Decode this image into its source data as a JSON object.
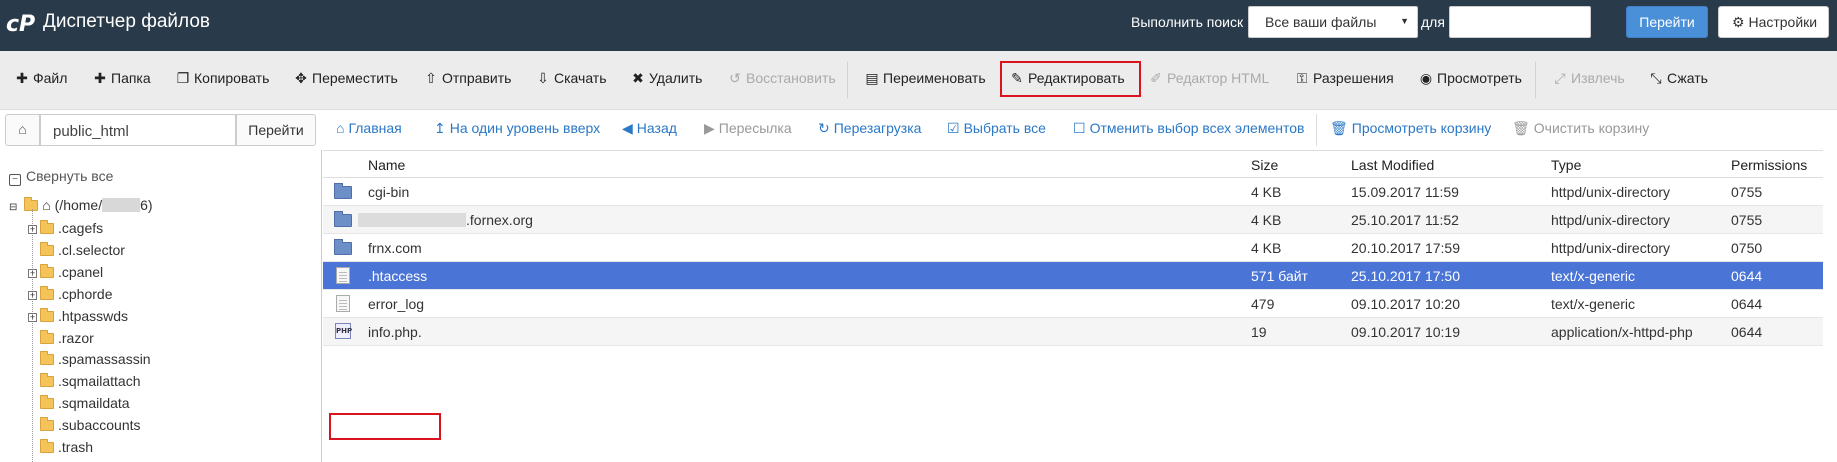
{
  "header": {
    "app_title": "Диспетчер файлов",
    "search_label": "Выполнить поиск",
    "search_scope": "Все ваши файлы",
    "for_label": "для",
    "search_value": "",
    "go_label": "Перейти",
    "settings_label": "Настройки"
  },
  "toolbar": {
    "file": "Файл",
    "folder": "Папка",
    "copy": "Копировать",
    "move": "Переместить",
    "upload": "Отправить",
    "download": "Скачать",
    "delete": "Удалить",
    "restore": "Восстановить",
    "rename": "Переименовать",
    "edit": "Редактировать",
    "html_editor": "Редактор HTML",
    "permissions": "Разрешения",
    "view": "Просмотреть",
    "extract": "Извлечь",
    "compress": "Сжать"
  },
  "pathbar": {
    "path": "public_html",
    "go_label": "Перейти",
    "home": "Главная",
    "up_one_level": "На один уровень вверх",
    "back": "Назад",
    "forward": "Пересылка",
    "reload": "Перезагрузка",
    "select_all": "Выбрать все",
    "deselect_all": "Отменить выбор всех элементов",
    "view_trash": "Просмотреть корзину",
    "empty_trash": "Очистить корзину"
  },
  "tree": {
    "collapse_all": "Свернуть все",
    "root_prefix": "(/home/",
    "root_suffix": "6)",
    "items": [
      {
        "name": ".cagefs",
        "expandable": true
      },
      {
        "name": ".cl.selector",
        "expandable": false
      },
      {
        "name": ".cpanel",
        "expandable": true
      },
      {
        "name": ".cphorde",
        "expandable": true
      },
      {
        "name": ".htpasswds",
        "expandable": true
      },
      {
        "name": ".razor",
        "expandable": false
      },
      {
        "name": ".spamassassin",
        "expandable": false
      },
      {
        "name": ".sqmailattach",
        "expandable": false
      },
      {
        "name": ".sqmaildata",
        "expandable": false
      },
      {
        "name": ".subaccounts",
        "expandable": false
      },
      {
        "name": ".trash",
        "expandable": false
      }
    ]
  },
  "files": {
    "columns": [
      "Name",
      "Size",
      "Last Modified",
      "Type",
      "Permissions"
    ],
    "rows": [
      {
        "icon": "folder-icon",
        "name": "cgi-bin",
        "size": "4 KB",
        "modified": "15.09.2017 11:59",
        "type": "httpd/unix-directory",
        "perms": "0755"
      },
      {
        "icon": "folder-icon",
        "name": ".fornex.org",
        "size": "4 KB",
        "modified": "25.10.2017 11:52",
        "type": "httpd/unix-directory",
        "perms": "0755"
      },
      {
        "icon": "folder-icon",
        "name": "frnx.com",
        "size": "4 KB",
        "modified": "20.10.2017 17:59",
        "type": "httpd/unix-directory",
        "perms": "0750"
      },
      {
        "icon": "text-file-icon",
        "name": ".htaccess",
        "size": "571 байт",
        "modified": "25.10.2017 17:50",
        "type": "text/x-generic",
        "perms": "0644"
      },
      {
        "icon": "text-file-icon",
        "name": "error_log",
        "size": "479",
        "modified": "09.10.2017 10:20",
        "type": "text/x-generic",
        "perms": "0644"
      },
      {
        "icon": "php-file-icon",
        "name": "info.php.",
        "size": "19",
        "modified": "09.10.2017 10:19",
        "type": "application/x-httpd-php",
        "perms": "0644"
      }
    ]
  },
  "colors": {
    "header_bg": "#293a4a",
    "selected_row": "#4a74d5",
    "link": "#2a78c6",
    "highlight": "#d9141e"
  }
}
